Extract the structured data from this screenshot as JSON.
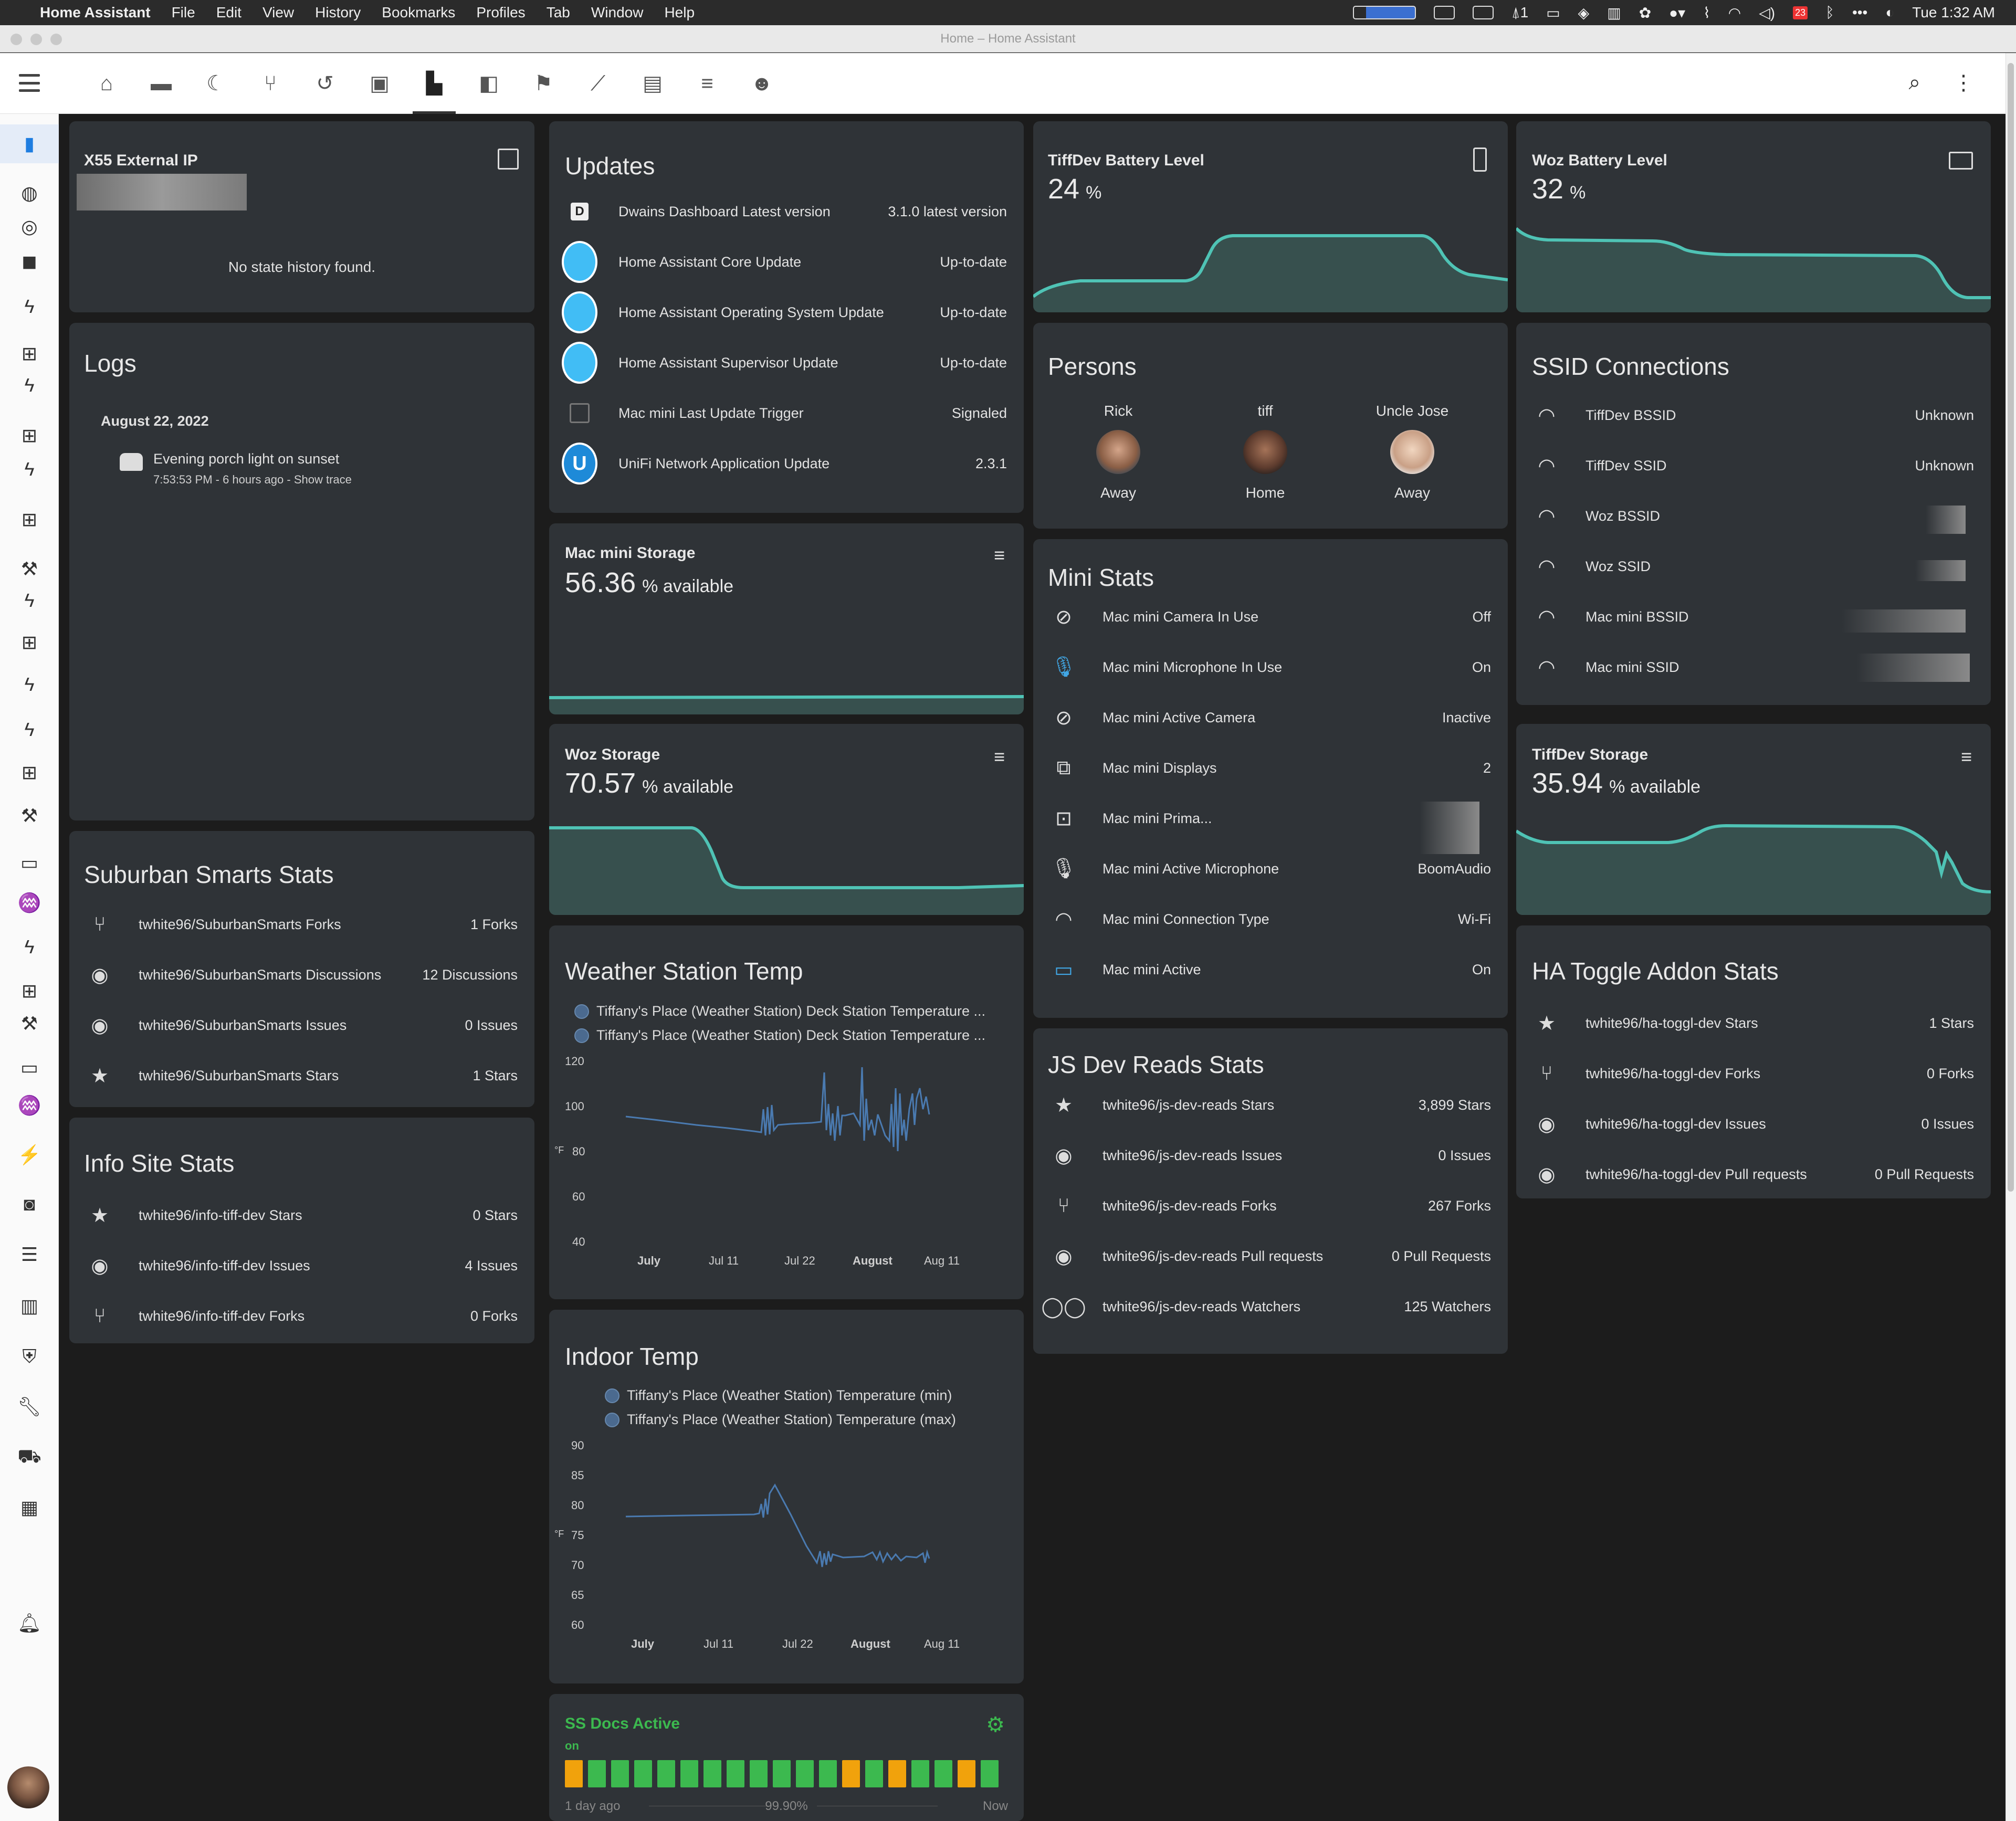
{
  "menubar": {
    "app_name": "Home Assistant",
    "menu_items": [
      "File",
      "Edit",
      "View",
      "History",
      "Bookmarks",
      "Profiles",
      "Tab",
      "Window",
      "Help"
    ],
    "clock": "Tue 1:32 AM",
    "status_badge": "1",
    "calendar_day": "23"
  },
  "window": {
    "title": "Home – Home Assistant"
  },
  "x55": {
    "title": "X55 External IP",
    "empty": "No state history found."
  },
  "logs": {
    "title": "Logs",
    "date": "August 22, 2022",
    "entry": "Evening porch light on sunset",
    "time": "7:53:53 PM - 6 hours ago - Show trace"
  },
  "suburban": {
    "title": "Suburban Smarts Stats",
    "rows": [
      {
        "icon": "fork-icon",
        "name": "twhite96/SuburbanSmarts Forks",
        "value": "1 Forks"
      },
      {
        "icon": "github-icon",
        "name": "twhite96/SuburbanSmarts Discussions",
        "value": "12 Discussions"
      },
      {
        "icon": "github-icon",
        "name": "twhite96/SuburbanSmarts Issues",
        "value": "0 Issues"
      },
      {
        "icon": "star-icon",
        "name": "twhite96/SuburbanSmarts Stars",
        "value": "1 Stars"
      }
    ]
  },
  "info": {
    "title": "Info Site Stats",
    "rows": [
      {
        "icon": "star-icon",
        "name": "twhite96/info-tiff-dev Stars",
        "value": "0 Stars"
      },
      {
        "icon": "github-icon",
        "name": "twhite96/info-tiff-dev Issues",
        "value": "4 Issues"
      },
      {
        "icon": "fork-icon",
        "name": "twhite96/info-tiff-dev Forks",
        "value": "0 Forks"
      }
    ]
  },
  "updates": {
    "title": "Updates",
    "rows": [
      {
        "icon": "dwains-icon",
        "name": "Dwains Dashboard Latest version",
        "value": "3.1.0 latest version"
      },
      {
        "icon": "home-assistant-icon",
        "name": "Home Assistant Core Update",
        "value": "Up-to-date"
      },
      {
        "icon": "home-assistant-icon",
        "name": "Home Assistant Operating System Update",
        "value": "Up-to-date"
      },
      {
        "icon": "home-assistant-icon",
        "name": "Home Assistant Supervisor Update",
        "value": "Up-to-date"
      },
      {
        "icon": "mac-icon",
        "name": "Mac mini Last Update Trigger",
        "value": "Signaled"
      },
      {
        "icon": "unifi-icon",
        "name": "UniFi Network Application Update",
        "value": "2.3.1"
      }
    ]
  },
  "mac_storage": {
    "title": "Mac mini Storage",
    "value": "56.36",
    "unit": "% available"
  },
  "woz_storage": {
    "title": "Woz Storage",
    "value": "70.57",
    "unit": "% available"
  },
  "weather": {
    "title": "Weather Station Temp",
    "legend": [
      "Tiffany's Place (Weather Station) Deck Station Temperature ...",
      "Tiffany's Place (Weather Station) Deck Station Temperature ..."
    ],
    "yticks": [
      "120",
      "100",
      "80",
      "60",
      "40"
    ],
    "xticks": [
      "July",
      "Jul 11",
      "Jul 22",
      "August",
      "Aug 11"
    ],
    "unit": "°F"
  },
  "indoor": {
    "title": "Indoor Temp",
    "legend": [
      "Tiffany's Place (Weather Station) Temperature (min)",
      "Tiffany's Place (Weather Station) Temperature (max)"
    ],
    "yticks": [
      "90",
      "85",
      "80",
      "75",
      "70",
      "65",
      "60"
    ],
    "xticks": [
      "July",
      "Jul 11",
      "Jul 22",
      "August",
      "Aug 11"
    ],
    "unit": "°F"
  },
  "ssdocs": {
    "title": "SS Docs Active",
    "state": "on",
    "from": "1 day ago",
    "pct": "99.90%",
    "to": "Now"
  },
  "tiff_battery": {
    "title": "TiffDev Battery Level",
    "value": "24",
    "unit": "%"
  },
  "woz_battery": {
    "title": "Woz Battery Level",
    "value": "32",
    "unit": "%"
  },
  "persons": {
    "title": "Persons",
    "people": [
      {
        "name": "Rick",
        "state": "Away"
      },
      {
        "name": "tiff",
        "state": "Home"
      },
      {
        "name": "Uncle Jose",
        "state": "Away"
      }
    ]
  },
  "mini": {
    "title": "Mini Stats",
    "rows": [
      {
        "icon": "camera-off-icon",
        "name": "Mac mini Camera In Use",
        "value": "Off"
      },
      {
        "icon": "microphone-icon",
        "name": "Mac mini Microphone In Use",
        "value": "On"
      },
      {
        "icon": "camera-off-icon",
        "name": "Mac mini Active Camera",
        "value": "Inactive"
      },
      {
        "icon": "monitor-multiple-icon",
        "name": "Mac mini Displays",
        "value": "2"
      },
      {
        "icon": "monitor-star-icon",
        "name": "Mac mini Prima...",
        "value": ""
      },
      {
        "icon": "microphone-icon",
        "name": "Mac mini Active Microphone",
        "value": "BoomAudio"
      },
      {
        "icon": "wifi-icon",
        "name": "Mac mini Connection Type",
        "value": "Wi-Fi"
      },
      {
        "icon": "monitor-icon",
        "name": "Mac mini Active",
        "value": "On"
      }
    ]
  },
  "jsdev": {
    "title": "JS Dev Reads Stats",
    "rows": [
      {
        "icon": "star-icon",
        "name": "twhite96/js-dev-reads Stars",
        "value": "3,899 Stars"
      },
      {
        "icon": "github-icon",
        "name": "twhite96/js-dev-reads Issues",
        "value": "0 Issues"
      },
      {
        "icon": "fork-icon",
        "name": "twhite96/js-dev-reads Forks",
        "value": "267 Forks"
      },
      {
        "icon": "github-icon",
        "name": "twhite96/js-dev-reads Pull requests",
        "value": "0 Pull Requests"
      },
      {
        "icon": "glasses-icon",
        "name": "twhite96/js-dev-reads Watchers",
        "value": "125 Watchers"
      }
    ]
  },
  "ssid": {
    "title": "SSID Connections",
    "rows": [
      {
        "icon": "wifi-star-icon",
        "name": "TiffDev BSSID",
        "value": "Unknown"
      },
      {
        "icon": "wifi-icon",
        "name": "TiffDev SSID",
        "value": "Unknown"
      },
      {
        "icon": "wifi-star-icon",
        "name": "Woz BSSID",
        "value": ""
      },
      {
        "icon": "wifi-icon",
        "name": "Woz SSID",
        "value": ""
      },
      {
        "icon": "wifi-star-icon",
        "name": "Mac mini BSSID",
        "value": ""
      },
      {
        "icon": "wifi-icon",
        "name": "Mac mini SSID",
        "value": ""
      }
    ]
  },
  "tiff_storage": {
    "title": "TiffDev Storage",
    "value": "35.94",
    "unit": "% available"
  },
  "toggl": {
    "title": "HA Toggle Addon Stats",
    "rows": [
      {
        "icon": "star-icon",
        "name": "twhite96/ha-toggl-dev Stars",
        "value": "1 Stars"
      },
      {
        "icon": "fork-icon",
        "name": "twhite96/ha-toggl-dev Forks",
        "value": "0 Forks"
      },
      {
        "icon": "github-icon",
        "name": "twhite96/ha-toggl-dev Issues",
        "value": "0 Issues"
      },
      {
        "icon": "github-icon",
        "name": "twhite96/ha-toggl-dev Pull requests",
        "value": "0 Pull Requests"
      }
    ]
  },
  "colors": {
    "accent": "#4fc3b5",
    "chart_line": "#4a7ab0",
    "active_blue": "#1e7de0",
    "green": "#3cb94f",
    "orange": "#f1a20c"
  }
}
